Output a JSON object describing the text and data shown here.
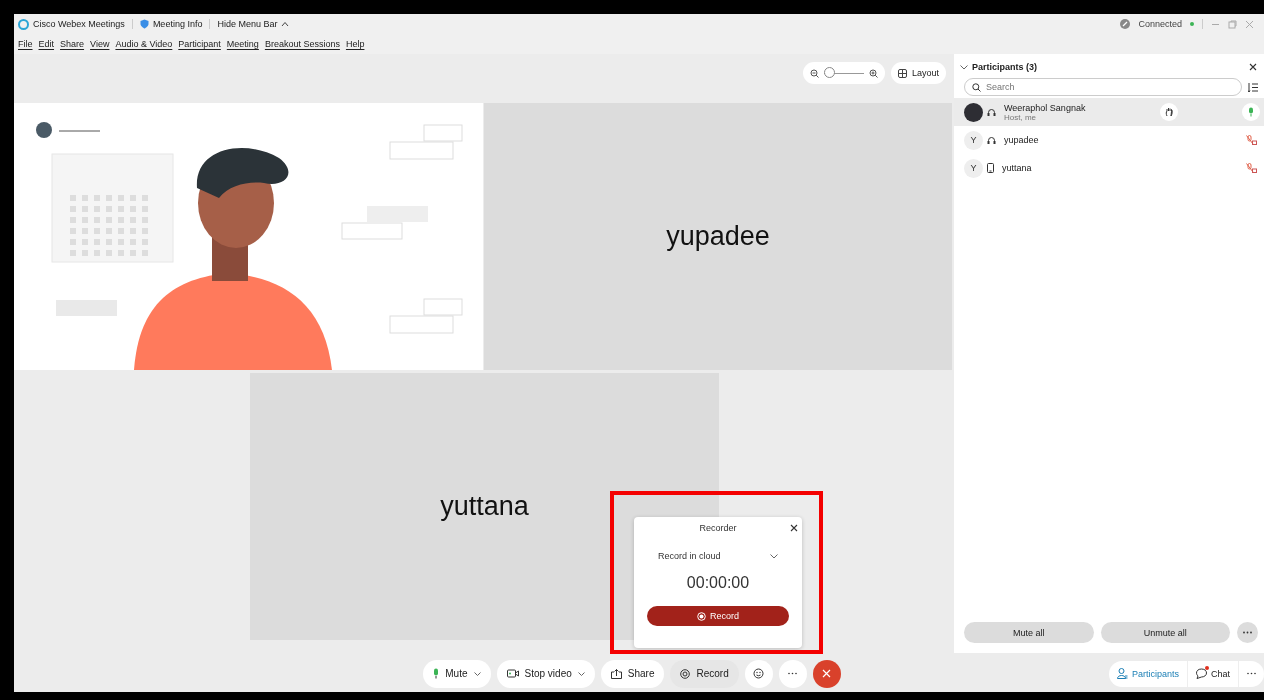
{
  "title_bar": {
    "app": "Cisco Webex Meetings",
    "meeting_info": "Meeting Info",
    "hide_menu": "Hide Menu Bar",
    "status": "Connected",
    "connected": true
  },
  "menu": [
    "File",
    "Edit",
    "Share",
    "View",
    "Audio & Video",
    "Participant",
    "Meeting",
    "Breakout Sessions",
    "Help"
  ],
  "view_controls": {
    "zoom": {
      "level": 0
    },
    "layout": "Layout"
  },
  "tiles": [
    {
      "kind": "illustration"
    },
    {
      "kind": "name",
      "name": "yupadee"
    },
    {
      "kind": "name",
      "name": "yuttana"
    }
  ],
  "recorder": {
    "title": "Recorder",
    "mode": "Record in cloud",
    "time": "00:00:00",
    "button": "Record",
    "highlighted": true
  },
  "participants_panel": {
    "title": "Participants (3)",
    "expanded": true,
    "search": {
      "placeholder": "Search"
    },
    "items": [
      {
        "name": "Weeraphol Sangnak",
        "subtitle": "Host, me",
        "has_photo": true,
        "kind": "headset",
        "muted": false,
        "selected": true
      },
      {
        "name": "yupadee",
        "initial": "Y",
        "has_photo": false,
        "kind": "headset",
        "muted": true,
        "selected": false
      },
      {
        "name": "yuttana",
        "initial": "Y",
        "has_photo": false,
        "kind": "phone",
        "muted": true,
        "selected": false
      }
    ],
    "buttons": [
      "Mute all",
      "Unmute all"
    ]
  },
  "toolbar": [
    {
      "kind": "mute",
      "label": "Mute"
    },
    {
      "kind": "video",
      "label": "Stop video"
    },
    {
      "kind": "share",
      "label": "Share"
    },
    {
      "kind": "record",
      "label": "Record"
    },
    {
      "kind": "reactions"
    },
    {
      "kind": "more"
    },
    {
      "kind": "leave"
    }
  ],
  "side_tabs": [
    {
      "kind": "participants",
      "label": "Participants",
      "selected": true,
      "unread": false
    },
    {
      "kind": "chat",
      "label": "Chat",
      "selected": false,
      "unread": true
    }
  ]
}
